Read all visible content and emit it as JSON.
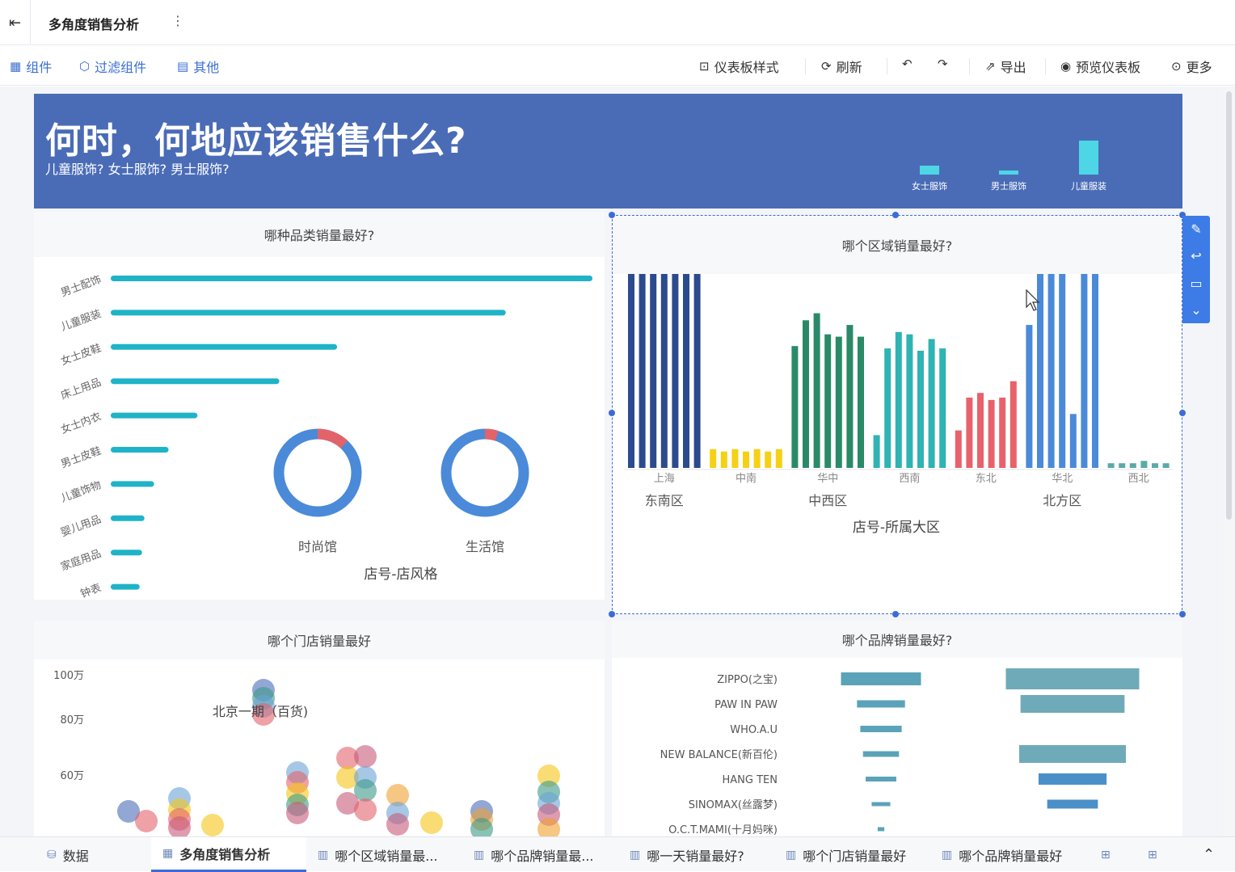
{
  "topbar": {
    "title": "多角度销售分析",
    "exit_icon": "exit-icon",
    "more_icon": "⋮"
  },
  "toolbar": {
    "left": [
      {
        "label": "组件",
        "icon": "chart-add-icon"
      },
      {
        "label": "过滤组件",
        "icon": "filter-cube-icon"
      },
      {
        "label": "其他",
        "icon": "doc-add-icon"
      }
    ],
    "right": {
      "style": "仪表板样式",
      "refresh": "刷新",
      "export": "导出",
      "preview": "预览仪表板",
      "more": "更多"
    }
  },
  "banner": {
    "title": "何时，何地应该销售什么?",
    "subtitle": "儿童服饰? 女士服饰? 男士服饰?",
    "bars": [
      {
        "label": "女士服饰",
        "value": 0.25
      },
      {
        "label": "男士服饰",
        "value": 0.12
      },
      {
        "label": "儿童服装",
        "value": 1.0
      }
    ],
    "bar_color": "#4dd7e6",
    "bg_color": "#4a6cb7"
  },
  "panels": {
    "category": {
      "title": "哪种品类销量最好?"
    },
    "region": {
      "title": "哪个区域销量最好?"
    },
    "store": {
      "title": "哪个门店销量最好"
    },
    "brand": {
      "title": "哪个品牌销量最好?"
    }
  },
  "chart_data": [
    {
      "type": "bar",
      "orientation": "horizontal",
      "categories": [
        "男士配饰",
        "儿童服装",
        "女士皮鞋",
        "床上用品",
        "女士内衣",
        "男士皮鞋",
        "儿童饰物",
        "婴儿用品",
        "家庭用品",
        "钟表"
      ],
      "values": [
        100,
        82,
        47,
        35,
        18,
        12,
        9,
        7,
        6.5,
        6
      ],
      "color": "#1fb3c8",
      "donuts": {
        "xlabel": "店号-店风格",
        "items": [
          {
            "label": "时尚馆",
            "share_red": 0.12
          },
          {
            "label": "生活馆",
            "share_red": 0.05
          }
        ],
        "colors": {
          "main": "#4a8ad9",
          "accent": "#e2636a"
        }
      }
    },
    {
      "type": "bar",
      "xlabel": "店号-所属大区",
      "groups": [
        {
          "region": "东南区",
          "subs": [
            "上海"
          ],
          "color": "#2c4a8e",
          "values": [
            92,
            94,
            91,
            86,
            90,
            88,
            83
          ]
        },
        {
          "region": "",
          "subs": [
            "中南"
          ],
          "color": "#f5d116",
          "values": [
            8,
            7,
            8,
            7,
            8,
            7,
            8
          ]
        },
        {
          "region": "中西区",
          "subs": [
            "华中"
          ],
          "color": "#2a8a68",
          "values": [
            52,
            63,
            66,
            57,
            56,
            61,
            56
          ]
        },
        {
          "region": "",
          "subs": [
            "西南"
          ],
          "color": "#2fb3b3",
          "values": [
            14,
            51,
            58,
            57,
            50,
            55,
            51
          ]
        },
        {
          "region": "",
          "subs": [
            "东北"
          ],
          "color": "#e8626b",
          "values": [
            16,
            30,
            32,
            29,
            30,
            37
          ]
        },
        {
          "region": "北方区",
          "subs": [
            "华北"
          ],
          "color": "#4a8ad9",
          "values": [
            61,
            91,
            87,
            84,
            23,
            90,
            85
          ]
        },
        {
          "region": "",
          "subs": [
            "西北"
          ],
          "color": "#5aaaa8",
          "values": [
            2,
            2,
            2,
            3,
            2,
            2
          ]
        }
      ],
      "ylim": [
        0,
        100
      ]
    },
    {
      "type": "scatter",
      "ylabels": [
        "100万",
        "80万",
        "60万"
      ],
      "annotation": "北京一期（百货)",
      "colors": [
        "#4a6cb7",
        "#e2636a",
        "#6ba3d6",
        "#f5c518",
        "#3c9a88",
        "#c85a7a",
        "#f0a030"
      ]
    },
    {
      "type": "bar",
      "orientation": "horizontal",
      "categories": [
        "ZIPPO(之宝)",
        "PAW IN PAW",
        "WHO.A.U",
        "NEW BALANCE(新百伦)",
        "HANG TEN",
        "SINOMAX(丝露梦)",
        "O.C.T.MAMI(十月妈咪)"
      ],
      "series": [
        {
          "values": [
            60,
            36,
            31,
            27,
            23,
            14,
            5
          ],
          "color": "#5ba3b8"
        },
        {
          "values": [
            100,
            78,
            0,
            80,
            51,
            38,
            0
          ],
          "color": "#4b8fc8"
        }
      ]
    }
  ],
  "bottom": {
    "data": "数据",
    "tabs": [
      "多角度销售分析",
      "哪个区域销量最...",
      "哪个品牌销量最...",
      "哪一天销量最好?",
      "哪个门店销量最好",
      "哪个品牌销量最好"
    ]
  }
}
